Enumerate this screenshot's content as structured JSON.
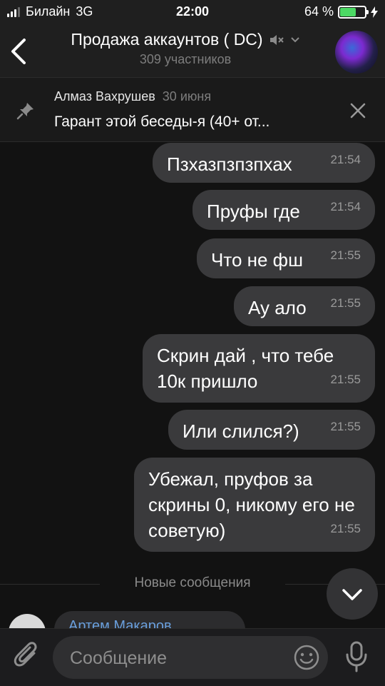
{
  "status_bar": {
    "carrier": "Билайн",
    "network": "3G",
    "time": "22:00",
    "battery_percent_label": "64 %",
    "battery_level": 0.64,
    "battery_color": "#4cd964"
  },
  "header": {
    "back_icon": "chevron-left-icon",
    "title": "Продажа аккаунтов ( DC)",
    "muted_icon": "speaker-muted-icon",
    "dropdown_icon": "chevron-down-icon",
    "subtitle": "309 участников"
  },
  "pinned": {
    "icon": "pin-icon",
    "author": "Алмаз Вахрушев",
    "date": "30 июня",
    "text": "Гарант этой беседы-я (40+ от...",
    "close_icon": "close-icon"
  },
  "messages": [
    {
      "text": "Пзхазпзпзпхах",
      "time": "21:54"
    },
    {
      "text": "Пруфы где",
      "time": "21:54"
    },
    {
      "text": "Что не фш",
      "time": "21:55"
    },
    {
      "text": "Ау ало",
      "time": "21:55"
    },
    {
      "text": "Скрин дай , что тебе 10к пришло",
      "time": "21:55"
    },
    {
      "text": "Или слился?)",
      "time": "21:55"
    },
    {
      "text": "Убежал, пруфов за скрины 0, никому его не советую)",
      "time": "21:55"
    }
  ],
  "new_messages_label": "Новые сообщения",
  "incoming_preview": {
    "author": "Артем Макаров"
  },
  "input_bar": {
    "placeholder": "Сообщение",
    "attach_icon": "paperclip-icon",
    "emoji_icon": "smiley-icon",
    "mic_icon": "microphone-icon",
    "scroll_icon": "chevron-down-icon"
  },
  "colors": {
    "background": "#121212",
    "bubble_outgoing": "#3a3a3c",
    "accent_link": "#6a9fdc"
  }
}
